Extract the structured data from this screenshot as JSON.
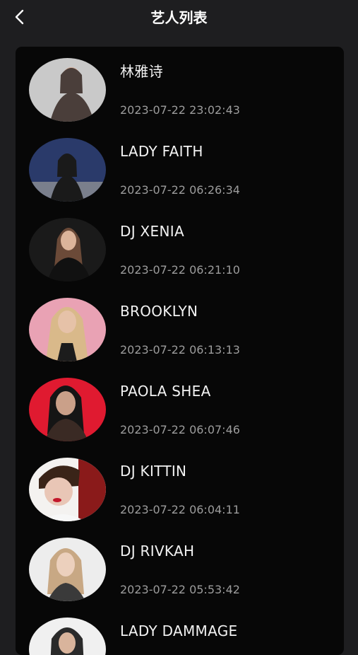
{
  "header": {
    "title": "艺人列表",
    "back_icon": "chevron-left-icon"
  },
  "colors": {
    "page_bg": "#1e1e20",
    "card_bg": "#070707",
    "name_text": "#f2f2f2",
    "time_text": "#9c9c9c"
  },
  "artists": [
    {
      "name": "林雅诗",
      "time": "2023-07-22 23:02:43",
      "avatar_bg": "#c9c9c9",
      "avatar_fg": "#4a3e3a"
    },
    {
      "name": "LADY FAITH",
      "time": "2023-07-22 06:26:34",
      "avatar_bg": "#2a3a6a",
      "avatar_fg": "#1a1a1a"
    },
    {
      "name": "DJ XENIA",
      "time": "2023-07-22 06:21:10",
      "avatar_bg": "#1a1a1a",
      "avatar_fg": "#6b4a38"
    },
    {
      "name": "BROOKLYN",
      "time": "2023-07-22 06:13:13",
      "avatar_bg": "#e9a2b4",
      "avatar_fg": "#d9b98a"
    },
    {
      "name": "PAOLA SHEA",
      "time": "2023-07-22 06:07:46",
      "avatar_bg": "#e01a30",
      "avatar_fg": "#3a2a24"
    },
    {
      "name": "DJ KITTIN",
      "time": "2023-07-22 06:04:11",
      "avatar_bg": "#f4f2f0",
      "avatar_fg": "#3a2418"
    },
    {
      "name": "DJ RIVKAH",
      "time": "2023-07-22 05:53:42",
      "avatar_bg": "#ededed",
      "avatar_fg": "#c8a884"
    },
    {
      "name": "LADY DAMMAGE",
      "time": "",
      "avatar_bg": "#f0f0f0",
      "avatar_fg": "#2a2a2a"
    }
  ]
}
